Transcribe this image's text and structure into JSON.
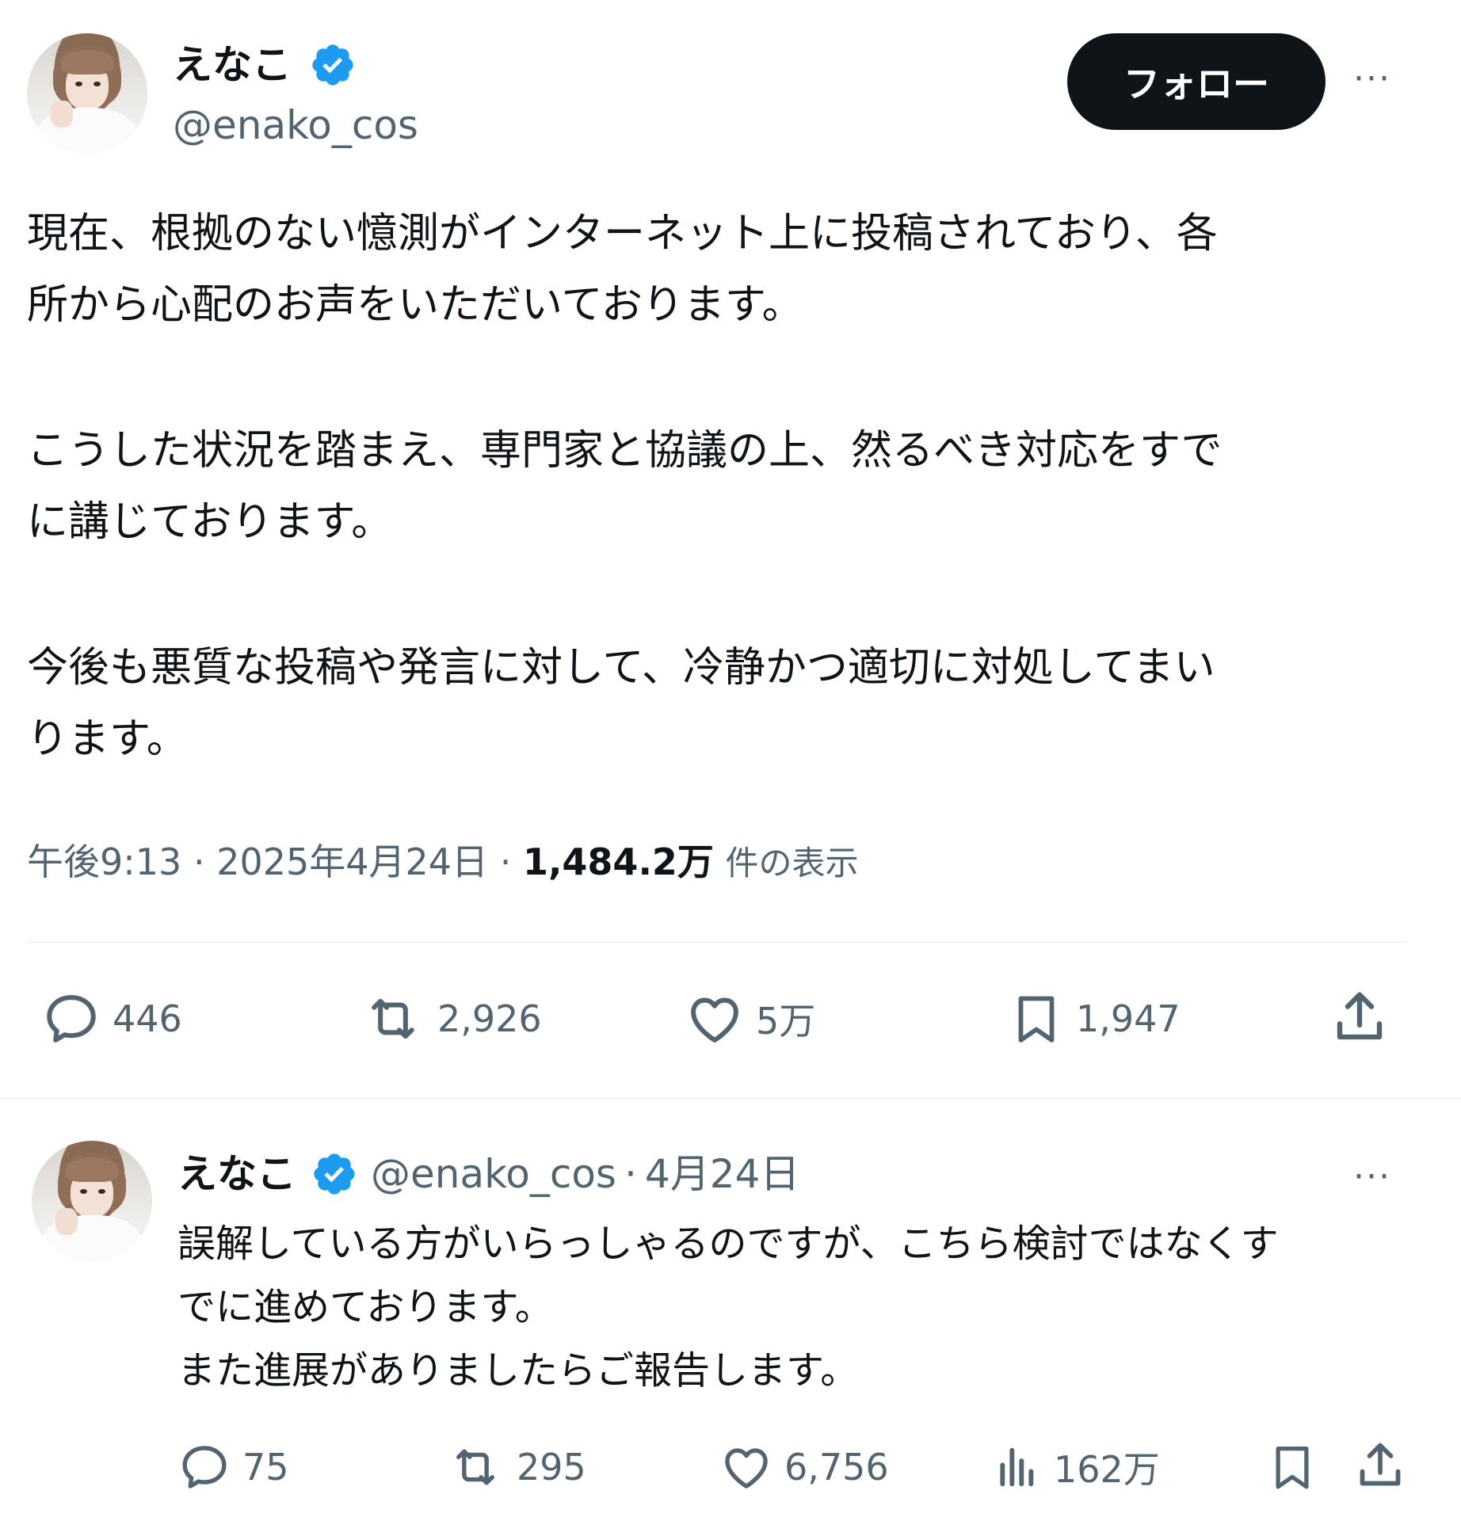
{
  "main_tweet": {
    "display_name": "えなこ",
    "handle": "@enako_cos",
    "follow_label": "フォロー",
    "more_label": "···",
    "paragraphs": [
      "現在、根拠のない憶測がインターネット上に投稿されており、各\n所から心配のお声をいただいております。",
      "こうした状況を踏まえ、専門家と協議の上、然るべき対応をすで\nに講じております。",
      "今後も悪質な投稿や発言に対して、冷静かつ適切に対処してまい\nります。"
    ],
    "time": "午後9:13",
    "date": "2025年4月24日",
    "views": "1,484.2万",
    "views_suffix": "件の表示",
    "actions": {
      "replies": "446",
      "retweets": "2,926",
      "likes": "5万",
      "bookmarks": "1,947"
    }
  },
  "reply_tweet": {
    "display_name": "えなこ",
    "handle": "@enako_cos",
    "date": "4月24日",
    "more_label": "···",
    "text": "誤解している方がいらっしゃるのですが、こちら検討ではなくす\nでに進めております。\nまた進展がありましたらご報告します。",
    "actions": {
      "replies": "75",
      "retweets": "295",
      "likes": "6,756",
      "views": "162万"
    }
  },
  "colors": {
    "text": "#0f1419",
    "muted": "#536471",
    "verified_blue": "#1d9bf0",
    "button": "#0f1419"
  },
  "icons": [
    "verified-badge-icon",
    "more-icon",
    "reply-icon",
    "retweet-icon",
    "like-icon",
    "bookmark-icon",
    "share-icon",
    "views-icon"
  ]
}
